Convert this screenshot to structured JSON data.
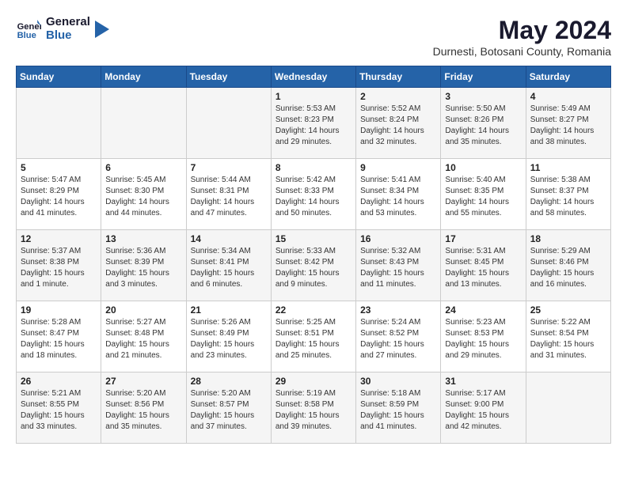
{
  "header": {
    "logo_line1": "General",
    "logo_line2": "Blue",
    "month_year": "May 2024",
    "location": "Durnesti, Botosani County, Romania"
  },
  "weekdays": [
    "Sunday",
    "Monday",
    "Tuesday",
    "Wednesday",
    "Thursday",
    "Friday",
    "Saturday"
  ],
  "weeks": [
    [
      {
        "day": "",
        "sunrise": "",
        "sunset": "",
        "daylight": ""
      },
      {
        "day": "",
        "sunrise": "",
        "sunset": "",
        "daylight": ""
      },
      {
        "day": "",
        "sunrise": "",
        "sunset": "",
        "daylight": ""
      },
      {
        "day": "1",
        "sunrise": "Sunrise: 5:53 AM",
        "sunset": "Sunset: 8:23 PM",
        "daylight": "Daylight: 14 hours and 29 minutes."
      },
      {
        "day": "2",
        "sunrise": "Sunrise: 5:52 AM",
        "sunset": "Sunset: 8:24 PM",
        "daylight": "Daylight: 14 hours and 32 minutes."
      },
      {
        "day": "3",
        "sunrise": "Sunrise: 5:50 AM",
        "sunset": "Sunset: 8:26 PM",
        "daylight": "Daylight: 14 hours and 35 minutes."
      },
      {
        "day": "4",
        "sunrise": "Sunrise: 5:49 AM",
        "sunset": "Sunset: 8:27 PM",
        "daylight": "Daylight: 14 hours and 38 minutes."
      }
    ],
    [
      {
        "day": "5",
        "sunrise": "Sunrise: 5:47 AM",
        "sunset": "Sunset: 8:29 PM",
        "daylight": "Daylight: 14 hours and 41 minutes."
      },
      {
        "day": "6",
        "sunrise": "Sunrise: 5:45 AM",
        "sunset": "Sunset: 8:30 PM",
        "daylight": "Daylight: 14 hours and 44 minutes."
      },
      {
        "day": "7",
        "sunrise": "Sunrise: 5:44 AM",
        "sunset": "Sunset: 8:31 PM",
        "daylight": "Daylight: 14 hours and 47 minutes."
      },
      {
        "day": "8",
        "sunrise": "Sunrise: 5:42 AM",
        "sunset": "Sunset: 8:33 PM",
        "daylight": "Daylight: 14 hours and 50 minutes."
      },
      {
        "day": "9",
        "sunrise": "Sunrise: 5:41 AM",
        "sunset": "Sunset: 8:34 PM",
        "daylight": "Daylight: 14 hours and 53 minutes."
      },
      {
        "day": "10",
        "sunrise": "Sunrise: 5:40 AM",
        "sunset": "Sunset: 8:35 PM",
        "daylight": "Daylight: 14 hours and 55 minutes."
      },
      {
        "day": "11",
        "sunrise": "Sunrise: 5:38 AM",
        "sunset": "Sunset: 8:37 PM",
        "daylight": "Daylight: 14 hours and 58 minutes."
      }
    ],
    [
      {
        "day": "12",
        "sunrise": "Sunrise: 5:37 AM",
        "sunset": "Sunset: 8:38 PM",
        "daylight": "Daylight: 15 hours and 1 minute."
      },
      {
        "day": "13",
        "sunrise": "Sunrise: 5:36 AM",
        "sunset": "Sunset: 8:39 PM",
        "daylight": "Daylight: 15 hours and 3 minutes."
      },
      {
        "day": "14",
        "sunrise": "Sunrise: 5:34 AM",
        "sunset": "Sunset: 8:41 PM",
        "daylight": "Daylight: 15 hours and 6 minutes."
      },
      {
        "day": "15",
        "sunrise": "Sunrise: 5:33 AM",
        "sunset": "Sunset: 8:42 PM",
        "daylight": "Daylight: 15 hours and 9 minutes."
      },
      {
        "day": "16",
        "sunrise": "Sunrise: 5:32 AM",
        "sunset": "Sunset: 8:43 PM",
        "daylight": "Daylight: 15 hours and 11 minutes."
      },
      {
        "day": "17",
        "sunrise": "Sunrise: 5:31 AM",
        "sunset": "Sunset: 8:45 PM",
        "daylight": "Daylight: 15 hours and 13 minutes."
      },
      {
        "day": "18",
        "sunrise": "Sunrise: 5:29 AM",
        "sunset": "Sunset: 8:46 PM",
        "daylight": "Daylight: 15 hours and 16 minutes."
      }
    ],
    [
      {
        "day": "19",
        "sunrise": "Sunrise: 5:28 AM",
        "sunset": "Sunset: 8:47 PM",
        "daylight": "Daylight: 15 hours and 18 minutes."
      },
      {
        "day": "20",
        "sunrise": "Sunrise: 5:27 AM",
        "sunset": "Sunset: 8:48 PM",
        "daylight": "Daylight: 15 hours and 21 minutes."
      },
      {
        "day": "21",
        "sunrise": "Sunrise: 5:26 AM",
        "sunset": "Sunset: 8:49 PM",
        "daylight": "Daylight: 15 hours and 23 minutes."
      },
      {
        "day": "22",
        "sunrise": "Sunrise: 5:25 AM",
        "sunset": "Sunset: 8:51 PM",
        "daylight": "Daylight: 15 hours and 25 minutes."
      },
      {
        "day": "23",
        "sunrise": "Sunrise: 5:24 AM",
        "sunset": "Sunset: 8:52 PM",
        "daylight": "Daylight: 15 hours and 27 minutes."
      },
      {
        "day": "24",
        "sunrise": "Sunrise: 5:23 AM",
        "sunset": "Sunset: 8:53 PM",
        "daylight": "Daylight: 15 hours and 29 minutes."
      },
      {
        "day": "25",
        "sunrise": "Sunrise: 5:22 AM",
        "sunset": "Sunset: 8:54 PM",
        "daylight": "Daylight: 15 hours and 31 minutes."
      }
    ],
    [
      {
        "day": "26",
        "sunrise": "Sunrise: 5:21 AM",
        "sunset": "Sunset: 8:55 PM",
        "daylight": "Daylight: 15 hours and 33 minutes."
      },
      {
        "day": "27",
        "sunrise": "Sunrise: 5:20 AM",
        "sunset": "Sunset: 8:56 PM",
        "daylight": "Daylight: 15 hours and 35 minutes."
      },
      {
        "day": "28",
        "sunrise": "Sunrise: 5:20 AM",
        "sunset": "Sunset: 8:57 PM",
        "daylight": "Daylight: 15 hours and 37 minutes."
      },
      {
        "day": "29",
        "sunrise": "Sunrise: 5:19 AM",
        "sunset": "Sunset: 8:58 PM",
        "daylight": "Daylight: 15 hours and 39 minutes."
      },
      {
        "day": "30",
        "sunrise": "Sunrise: 5:18 AM",
        "sunset": "Sunset: 8:59 PM",
        "daylight": "Daylight: 15 hours and 41 minutes."
      },
      {
        "day": "31",
        "sunrise": "Sunrise: 5:17 AM",
        "sunset": "Sunset: 9:00 PM",
        "daylight": "Daylight: 15 hours and 42 minutes."
      },
      {
        "day": "",
        "sunrise": "",
        "sunset": "",
        "daylight": ""
      }
    ]
  ]
}
